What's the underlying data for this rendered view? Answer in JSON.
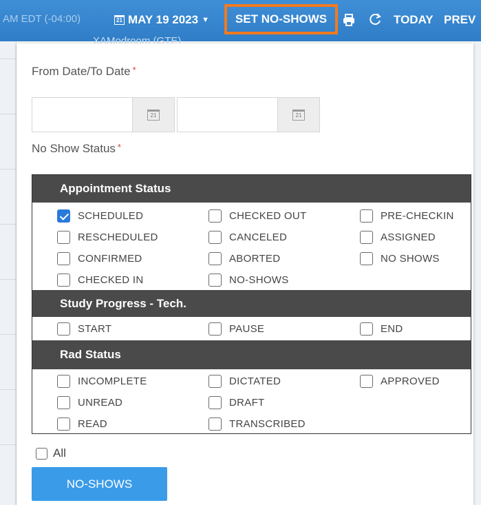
{
  "toolbar": {
    "timezone": "AM EDT (-04:00)",
    "date": "MAY 19 2023",
    "date_icon": "calendar-icon",
    "calendar_glyph": "21",
    "set_noshows": "SET NO-SHOWS",
    "today": "TODAY",
    "prev": "PREV",
    "room": "XAModroom (GTE)",
    "highlight_color": "#f27a1f",
    "bar_color": "#3a88d0"
  },
  "dialog": {
    "from_to_label": "From Date/To Date",
    "required_mark": "*",
    "from_date_value": "",
    "to_date_value": "",
    "no_show_status_label": "No Show Status",
    "sections": [
      {
        "title": "Appointment Status",
        "items": [
          {
            "label": "SCHEDULED",
            "checked": true
          },
          {
            "label": "CHECKED OUT",
            "checked": false
          },
          {
            "label": "PRE-CHECKIN",
            "checked": false
          },
          {
            "label": "RESCHEDULED",
            "checked": false
          },
          {
            "label": "CANCELED",
            "checked": false
          },
          {
            "label": "ASSIGNED",
            "checked": false
          },
          {
            "label": "CONFIRMED",
            "checked": false
          },
          {
            "label": "ABORTED",
            "checked": false
          },
          {
            "label": "NO SHOWS",
            "checked": false
          },
          {
            "label": "CHECKED IN",
            "checked": false
          },
          {
            "label": "NO-SHOWS",
            "checked": false
          }
        ]
      },
      {
        "title": "Study Progress - Tech.",
        "items": [
          {
            "label": "START",
            "checked": false
          },
          {
            "label": "PAUSE",
            "checked": false
          },
          {
            "label": "END",
            "checked": false
          }
        ]
      },
      {
        "title": "Rad Status",
        "items": [
          {
            "label": "INCOMPLETE",
            "checked": false
          },
          {
            "label": "DICTATED",
            "checked": false
          },
          {
            "label": "APPROVED",
            "checked": false
          },
          {
            "label": "UNREAD",
            "checked": false
          },
          {
            "label": "DRAFT",
            "checked": false
          },
          {
            "label": "READ",
            "checked": false
          },
          {
            "label": "TRANSCRIBED",
            "checked": false
          }
        ]
      }
    ],
    "all_label": "All",
    "submit_label": "NO-SHOWS",
    "checkbox_color": "#2a7ad9",
    "button_color": "#3a9be8"
  }
}
